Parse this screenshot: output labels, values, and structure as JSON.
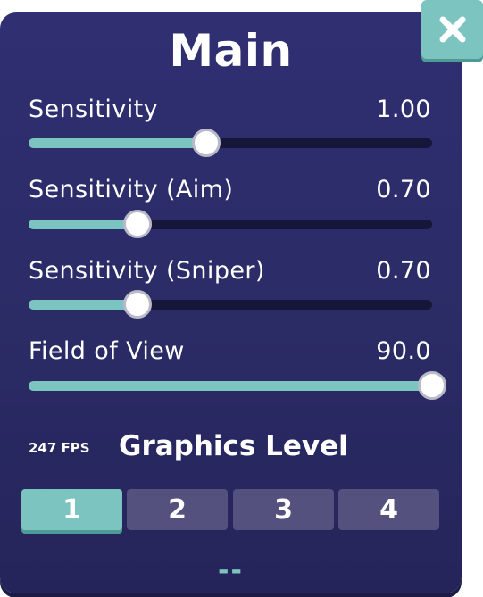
{
  "panel": {
    "title": "Main"
  },
  "close": {
    "icon": "close-icon"
  },
  "sliders": [
    {
      "label": "Sensitivity",
      "value": "1.00",
      "fraction": 0.44
    },
    {
      "label": "Sensitivity (Aim)",
      "value": "0.70",
      "fraction": 0.27
    },
    {
      "label": "Sensitivity (Sniper)",
      "value": "0.70",
      "fraction": 0.27
    },
    {
      "label": "Field of View",
      "value": "90.0",
      "fraction": 1.0
    }
  ],
  "graphics": {
    "fps": "247 FPS",
    "title": "Graphics Level",
    "levels": [
      "1",
      "2",
      "3",
      "4"
    ],
    "selected": "1"
  },
  "footer": {
    "placeholder": "--"
  },
  "colors": {
    "accent": "#7cc4c0",
    "panel": "#2d2d6b",
    "button": "#54517e"
  }
}
